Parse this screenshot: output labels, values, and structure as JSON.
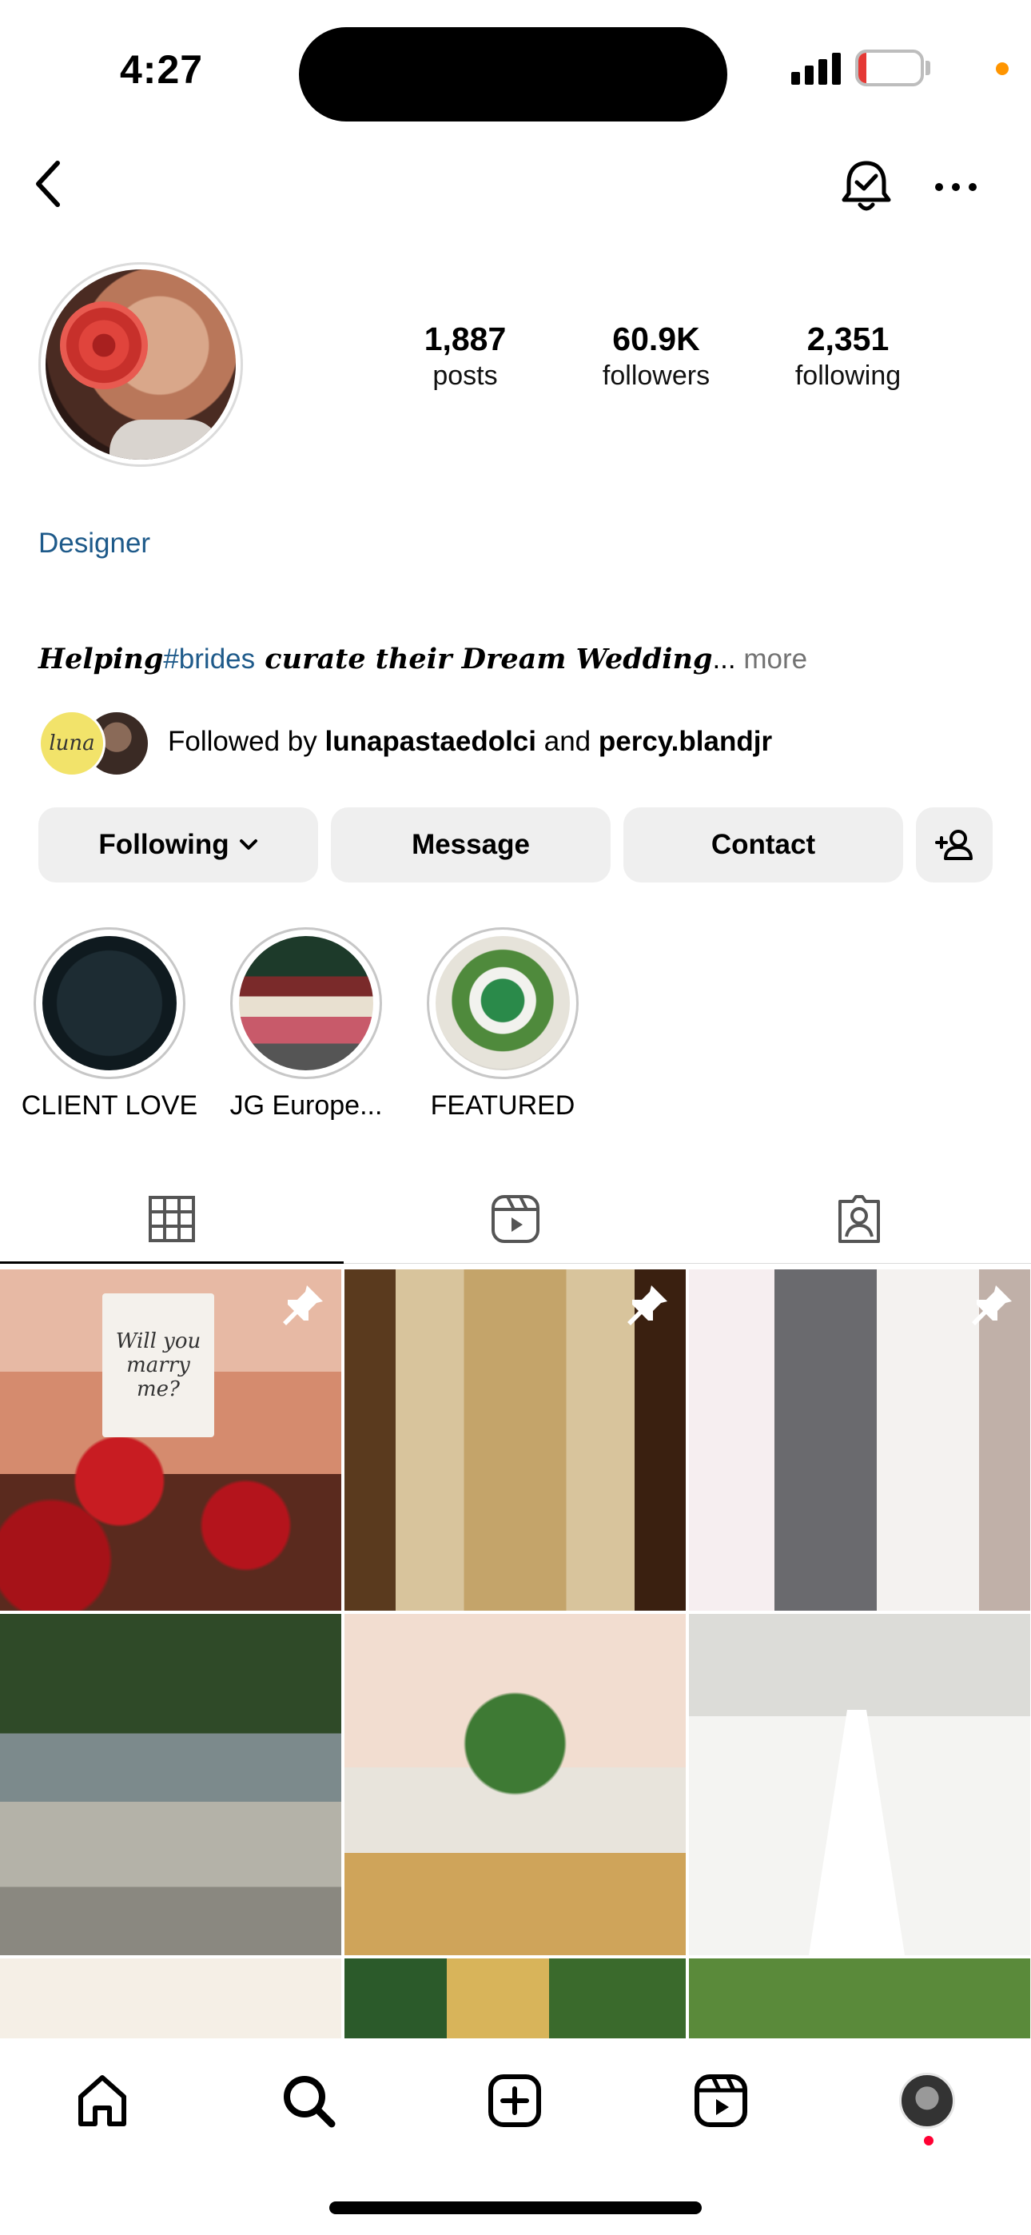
{
  "status_bar": {
    "time": "4:27",
    "battery": "13",
    "battery_level": 0.13,
    "signal_bars": 4
  },
  "header": {
    "back_icon": "chevron-left-icon",
    "bell_icon": "bell-check-icon",
    "more_icon": "ellipsis-icon"
  },
  "profile": {
    "stats": [
      {
        "value": "1,887",
        "label": "posts"
      },
      {
        "value": "60.9K",
        "label": "followers"
      },
      {
        "value": "2,351",
        "label": "following"
      }
    ],
    "category": "Designer",
    "bio": {
      "lead": "Helping",
      "hashtag": "#brides",
      "rest": " curate their Dream Wedding",
      "ellipsis": "...",
      "more": "more"
    },
    "followed_by": {
      "prefix": "Followed by ",
      "user1": "lunapastaedolci",
      "and": " and ",
      "user2": "percy.blandjr",
      "avatar1_text": "luna"
    }
  },
  "actions": {
    "following": "Following",
    "message": "Message",
    "contact": "Contact",
    "add_user_icon": "person-add-icon"
  },
  "highlights": [
    {
      "label": "CLIENT LOVE"
    },
    {
      "label": "JG Europe..."
    },
    {
      "label": "FEATURED"
    }
  ],
  "tabs": [
    {
      "icon": "grid-icon",
      "selected": true
    },
    {
      "icon": "reels-icon",
      "selected": false
    },
    {
      "icon": "tagged-icon",
      "selected": false
    }
  ],
  "posts": {
    "pinned": [
      true,
      true,
      true,
      false,
      false,
      false,
      false,
      false,
      false
    ],
    "p1_sign": "Will you marry me?"
  },
  "bottom_nav": [
    {
      "icon": "home-icon"
    },
    {
      "icon": "search-icon",
      "selected": true
    },
    {
      "icon": "create-icon"
    },
    {
      "icon": "reels-icon"
    },
    {
      "icon": "profile-avatar"
    }
  ]
}
